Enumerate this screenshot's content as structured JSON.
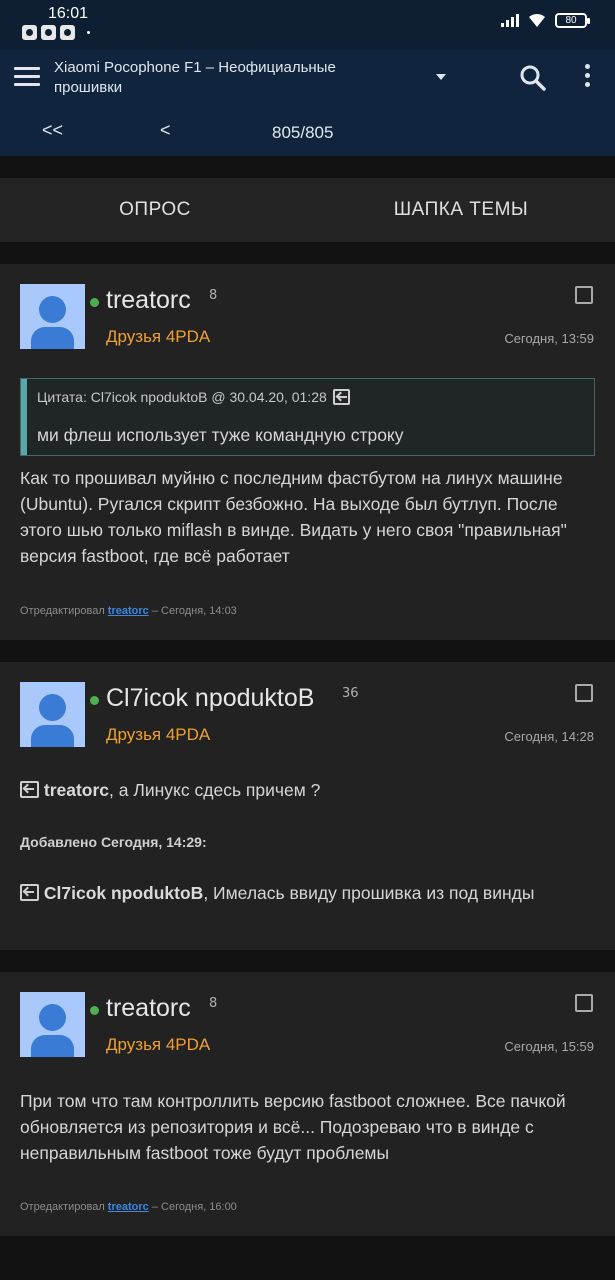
{
  "status_bar": {
    "time": "16:01",
    "battery": "80"
  },
  "app_bar": {
    "title": "Xiaomi Pocophone F1 – Неофициальные прошивки",
    "first_page": "<<",
    "prev_page": "<",
    "page_counter": "805/805"
  },
  "tabs": {
    "poll": "ОПРОС",
    "topic_header": "ШАПКА ТЕМЫ"
  },
  "posts": [
    {
      "author": "treatorc",
      "reputation": "8",
      "group": "Друзья 4PDA",
      "time": "Сегодня, 13:59",
      "quote_header": "Цитата: Cl7icok npoduktoB @ 30.04.20, 01:28",
      "quote_text": "ми флеш использует туже командную строку",
      "text": "Как то прошивал муйню с последним фастбутом на линух машине (Ubuntu). Ругался скрипт безбожно. На выходе был бутлуп. После этого шью только miflash в винде. Видать у него своя \"правильная\" версия fastboot, где всё работает",
      "edited_prefix": "Отредактировал",
      "edited_by": "treatorc",
      "edited_time": "– Сегодня, 14:03"
    },
    {
      "author": "Cl7icok npoduktoB",
      "reputation": "36",
      "group": "Друзья 4PDA",
      "time": "Сегодня, 14:28",
      "reply1_to": "treatorc",
      "reply1_text": ", а Линукс сдесь причем ?",
      "added": "Добавлено Сегодня, 14:29:",
      "reply2_to": "Cl7icok npoduktoB",
      "reply2_text": ", Имелась ввиду прошивка из под винды"
    },
    {
      "author": "treatorc",
      "reputation": "8",
      "group": "Друзья 4PDA",
      "time": "Сегодня, 15:59",
      "text": "При том что там контроллить версию fastboot сложнее. Все пачкой обновляется из репозитория и всё... Подозреваю что в винде с неправильным fastboot тоже будут проблемы",
      "edited_prefix": "Отредактировал",
      "edited_by": "treatorc",
      "edited_time": "– Сегодня, 16:00"
    }
  ]
}
